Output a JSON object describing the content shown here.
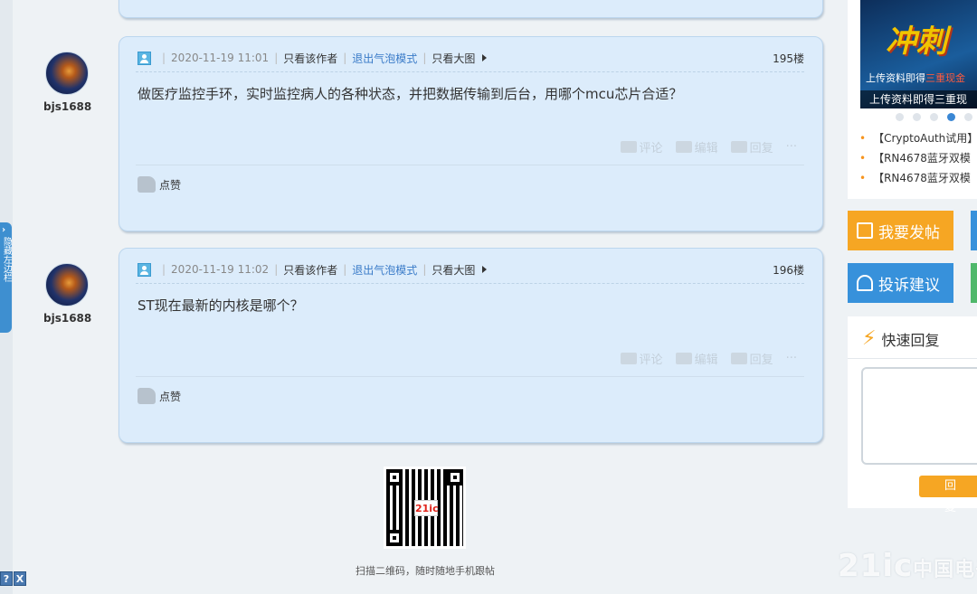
{
  "left_tab": {
    "label": "隐藏左边栏"
  },
  "bottom_tools": {
    "help": "?",
    "close": "X"
  },
  "posts": [
    {
      "author": "bjs1688",
      "date": "2020-11-19 11:01",
      "author_only": "只看该作者",
      "bubble_exit": "退出气泡模式",
      "big_image": "只看大图",
      "floor": "195楼",
      "content": "做医疗监控手环，实时监控病人的各种状态，并把数据传输到后台，用哪个mcu芯片合适？",
      "comment": "评论",
      "edit": "编辑",
      "reply": "回复",
      "more": "···",
      "like": "点赞"
    },
    {
      "author": "bjs1688",
      "date": "2020-11-19 11:02",
      "author_only": "只看该作者",
      "bubble_exit": "退出气泡模式",
      "big_image": "只看大图",
      "floor": "196楼",
      "content": "ST现在最新的内核是哪个？",
      "comment": "评论",
      "edit": "编辑",
      "reply": "回复",
      "more": "···",
      "like": "点赞"
    }
  ],
  "qr": {
    "logo": "21ic",
    "caption": "扫描二维码，随时随地手机跟帖"
  },
  "sidebar": {
    "banner_big": "冲刺",
    "banner_caption": "上传资料即得",
    "banner_caption_highlight": "三重现金",
    "banner_caption2": "上传资料即得三重现",
    "list": [
      "【CryptoAuth试用】",
      "【RN4678蓝牙双模",
      "【RN4678蓝牙双模"
    ],
    "post_button": "我要发帖",
    "complain_button": "投诉建议",
    "quick_reply_title": "快速回复",
    "reply_button": "回 复"
  },
  "watermark": {
    "text": "21ic",
    "sub": "中国电子网"
  }
}
